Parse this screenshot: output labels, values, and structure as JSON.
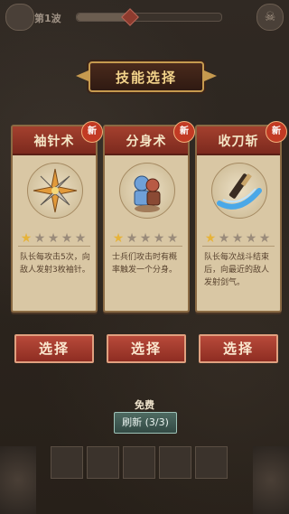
{
  "top": {
    "level_text": "第1波",
    "progress_fraction": 0.4
  },
  "title": "技能选择",
  "cards": [
    {
      "name": "袖针术",
      "badge": "新",
      "icon": "needle-burst-icon",
      "stars_filled": 1,
      "stars_total": 5,
      "description": "队长每攻击5次，向敌人发射3枚袖针。"
    },
    {
      "name": "分身术",
      "badge": "新",
      "icon": "clone-warrior-icon",
      "stars_filled": 1,
      "stars_total": 5,
      "description": "士兵们攻击时有概率触发一个分身。"
    },
    {
      "name": "收刀斩",
      "badge": "新",
      "icon": "sword-slash-icon",
      "stars_filled": 1,
      "stars_total": 5,
      "description": "队长每次战斗结束后，向最近的敌人发射剑气。"
    }
  ],
  "select_label": "选择",
  "refresh": {
    "cost_label": "免费",
    "label": "刷新 (3/3)"
  },
  "colors": {
    "accent_red": "#a4402e",
    "card_bg": "#d9c7a4",
    "star_on": "#e6b33a",
    "refresh_teal": "#4e6a62"
  }
}
